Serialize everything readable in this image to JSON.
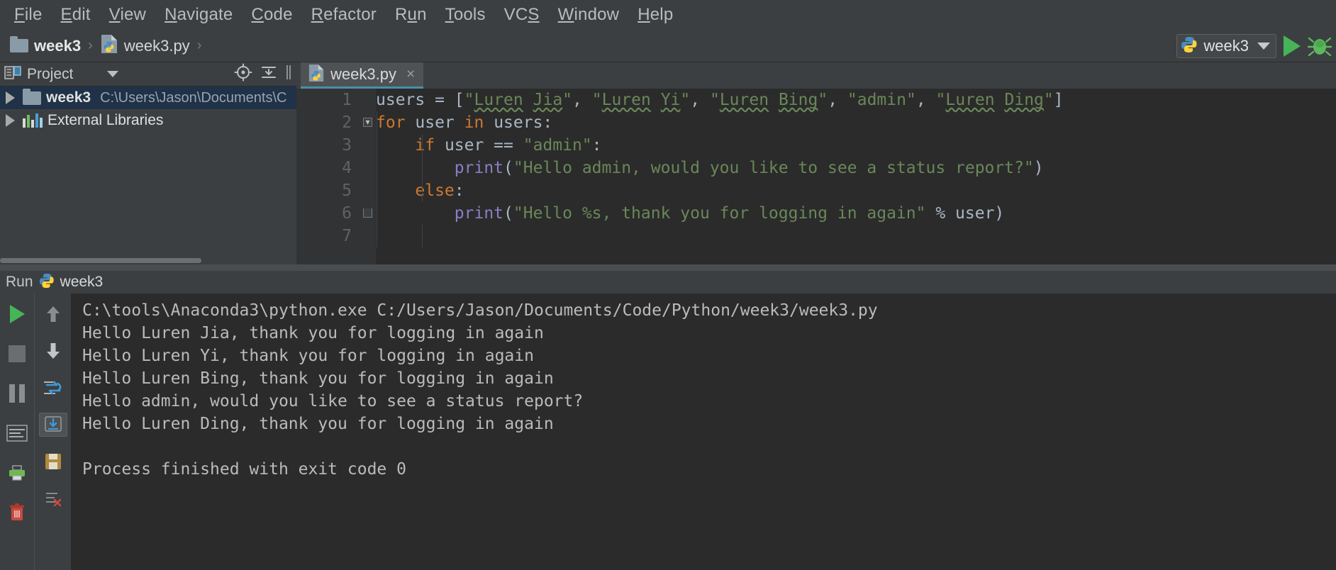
{
  "app": {
    "theme": "darcula",
    "colors": {
      "bg_chrome": "#3c3f41",
      "bg_editor": "#2b2b2b",
      "accent_tab": "#4a8fa8",
      "keyword": "#cc7832",
      "string": "#6a8759",
      "function": "#8a7ec8",
      "text": "#a9b7c6",
      "selection": "#1f3247",
      "run_green": "#45b557"
    }
  },
  "menubar": {
    "items": [
      {
        "label": "File",
        "mnemonic": "F"
      },
      {
        "label": "Edit",
        "mnemonic": "E"
      },
      {
        "label": "View",
        "mnemonic": "V"
      },
      {
        "label": "Navigate",
        "mnemonic": "N"
      },
      {
        "label": "Code",
        "mnemonic": "C"
      },
      {
        "label": "Refactor",
        "mnemonic": "R"
      },
      {
        "label": "Run",
        "mnemonic": "u"
      },
      {
        "label": "Tools",
        "mnemonic": "T"
      },
      {
        "label": "VCS",
        "mnemonic": "S"
      },
      {
        "label": "Window",
        "mnemonic": "W"
      },
      {
        "label": "Help",
        "mnemonic": "H"
      }
    ]
  },
  "navbar": {
    "breadcrumbs": [
      {
        "label": "week3",
        "icon": "folder-icon",
        "bold": true
      },
      {
        "label": "week3.py",
        "icon": "python-file-icon",
        "bold": false
      }
    ],
    "separator": "›",
    "run_config": {
      "label": "week3",
      "icon": "python-icon",
      "dropdown_icon": "chevron-down-icon"
    },
    "run_button": "run-icon",
    "debug_button": "debug-icon"
  },
  "project_panel": {
    "title": "Project",
    "dropdown_icon": "chevron-down-icon",
    "tools": [
      "locate-icon",
      "collapse-all-icon",
      "hide-icon"
    ],
    "tree": [
      {
        "label": "week3",
        "path": "C:\\Users\\Jason\\Documents\\C",
        "icon": "folder-icon",
        "expanded": false,
        "selected": true,
        "bold": true
      },
      {
        "label": "External Libraries",
        "path": "",
        "icon": "library-icon",
        "expanded": false,
        "selected": false,
        "bold": false
      }
    ]
  },
  "editor": {
    "tabs": [
      {
        "label": "week3.py",
        "icon": "python-file-icon",
        "active": true,
        "close_icon": "×"
      }
    ],
    "line_numbers": [
      "1",
      "2",
      "3",
      "4",
      "5",
      "6",
      "7"
    ],
    "code_lines": [
      {
        "number": "1",
        "tokens": [
          {
            "t": "users ",
            "c": "pun"
          },
          {
            "t": "= ",
            "c": "pun"
          },
          {
            "t": "[",
            "c": "pun"
          },
          {
            "t": "\"",
            "c": "str"
          },
          {
            "t": "Luren",
            "c": "str typo"
          },
          {
            "t": " ",
            "c": "str"
          },
          {
            "t": "Jia",
            "c": "str typo"
          },
          {
            "t": "\"",
            "c": "str"
          },
          {
            "t": ", ",
            "c": "pun"
          },
          {
            "t": "\"",
            "c": "str"
          },
          {
            "t": "Luren",
            "c": "str typo"
          },
          {
            "t": " ",
            "c": "str"
          },
          {
            "t": "Yi",
            "c": "str typo"
          },
          {
            "t": "\"",
            "c": "str"
          },
          {
            "t": ", ",
            "c": "pun"
          },
          {
            "t": "\"",
            "c": "str"
          },
          {
            "t": "Luren",
            "c": "str typo"
          },
          {
            "t": " ",
            "c": "str"
          },
          {
            "t": "Bing",
            "c": "str typo"
          },
          {
            "t": "\"",
            "c": "str"
          },
          {
            "t": ", ",
            "c": "pun"
          },
          {
            "t": "\"admin\"",
            "c": "str"
          },
          {
            "t": ", ",
            "c": "pun"
          },
          {
            "t": "\"",
            "c": "str"
          },
          {
            "t": "Luren",
            "c": "str typo"
          },
          {
            "t": " ",
            "c": "str"
          },
          {
            "t": "Ding",
            "c": "str typo"
          },
          {
            "t": "\"",
            "c": "str"
          },
          {
            "t": "]",
            "c": "pun"
          }
        ]
      },
      {
        "number": "2",
        "tokens": [
          {
            "t": "for",
            "c": "kw"
          },
          {
            "t": " user ",
            "c": "pun"
          },
          {
            "t": "in",
            "c": "kw"
          },
          {
            "t": " users:",
            "c": "pun"
          }
        ]
      },
      {
        "number": "3",
        "tokens": [
          {
            "t": "    ",
            "c": "pun"
          },
          {
            "t": "if",
            "c": "kw"
          },
          {
            "t": " user == ",
            "c": "pun"
          },
          {
            "t": "\"admin\"",
            "c": "str"
          },
          {
            "t": ":",
            "c": "pun"
          }
        ]
      },
      {
        "number": "4",
        "tokens": [
          {
            "t": "        ",
            "c": "pun"
          },
          {
            "t": "print",
            "c": "fn"
          },
          {
            "t": "(",
            "c": "pun"
          },
          {
            "t": "\"Hello admin, would you like to see a status report?\"",
            "c": "str"
          },
          {
            "t": ")",
            "c": "pun"
          }
        ]
      },
      {
        "number": "5",
        "tokens": [
          {
            "t": "    ",
            "c": "pun"
          },
          {
            "t": "else",
            "c": "kw"
          },
          {
            "t": ":",
            "c": "pun"
          }
        ]
      },
      {
        "number": "6",
        "tokens": [
          {
            "t": "        ",
            "c": "pun"
          },
          {
            "t": "print",
            "c": "fn"
          },
          {
            "t": "(",
            "c": "pun"
          },
          {
            "t": "\"Hello %s, thank you for logging in again\"",
            "c": "str"
          },
          {
            "t": " % user)",
            "c": "pun"
          }
        ]
      },
      {
        "number": "7",
        "tokens": []
      }
    ]
  },
  "run_panel": {
    "title": "Run",
    "config_label": "week3",
    "config_icon": "python-icon",
    "toolbar_left": [
      {
        "name": "rerun-icon",
        "active": false
      },
      {
        "name": "stop-icon",
        "active": false
      },
      {
        "name": "pause-icon",
        "active": false
      },
      {
        "name": "print-icon",
        "active": false
      },
      {
        "name": "soft-wrap-icon",
        "active": false
      },
      {
        "name": "trash-icon",
        "active": false
      }
    ],
    "toolbar_right": [
      {
        "name": "up-arrow-icon",
        "active": false
      },
      {
        "name": "down-arrow-icon",
        "active": false
      },
      {
        "name": "compare-icon",
        "active": false
      },
      {
        "name": "scroll-to-end-icon",
        "active": true
      },
      {
        "name": "save-console-icon",
        "active": false
      },
      {
        "name": "clear-all-icon",
        "active": false
      }
    ],
    "console_lines": [
      "C:\\tools\\Anaconda3\\python.exe C:/Users/Jason/Documents/Code/Python/week3/week3.py",
      "Hello Luren Jia, thank you for logging in again",
      "Hello Luren Yi, thank you for logging in again",
      "Hello Luren Bing, thank you for logging in again",
      "Hello admin, would you like to see a status report?",
      "Hello Luren Ding, thank you for logging in again",
      "",
      "Process finished with exit code 0"
    ]
  }
}
